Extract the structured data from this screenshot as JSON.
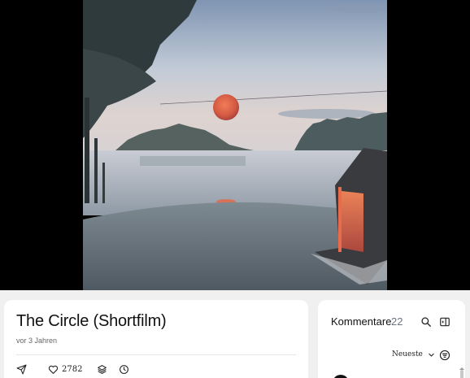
{
  "video": {
    "scene": "sunset-lake-cabin-artwork"
  },
  "info": {
    "title": "The Circle (Shortfilm)",
    "date": "vor 3 Jahren",
    "like_count": "2782",
    "actions": [
      "send-icon",
      "heart-icon",
      "layers-icon",
      "clock-icon"
    ]
  },
  "comments": {
    "title": "Kommentare",
    "count": "22",
    "sort_selected": "Neueste"
  },
  "colors": {
    "page_bg": "#f0f0f0",
    "card_bg": "#ffffff",
    "video_bg": "#000000",
    "count_gray": "#6b7280",
    "sun_orange": "#e8694a"
  }
}
